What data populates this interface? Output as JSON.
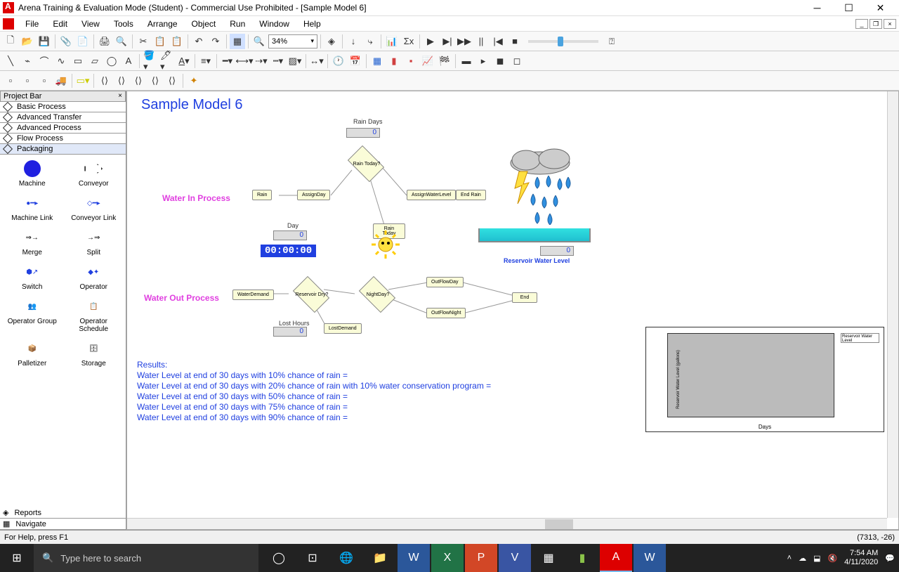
{
  "window": {
    "title": "Arena Training & Evaluation Mode (Student) - Commercial Use Prohibited - [Sample Model 6]"
  },
  "menu": [
    "File",
    "Edit",
    "View",
    "Tools",
    "Arrange",
    "Object",
    "Run",
    "Window",
    "Help"
  ],
  "zoom": "34%",
  "projectbar": {
    "title": "Project Bar",
    "groups": [
      "Basic Process",
      "Advanced Transfer",
      "Advanced Process",
      "Flow Process",
      "Packaging"
    ],
    "items": [
      "Machine",
      "Conveyor",
      "Machine Link",
      "Conveyor Link",
      "Merge",
      "Split",
      "Switch",
      "Operator",
      "Operator Group",
      "Operator Schedule",
      "Palletizer",
      "Storage"
    ],
    "bottom": [
      "Reports",
      "Navigate"
    ]
  },
  "canvas": {
    "title": "Sample Model 6",
    "water_in_label": "Water In Process",
    "water_out_label": "Water Out Process",
    "rain_days_label": "Rain Days",
    "rain_days_value": "0",
    "day_label": "Day",
    "day_value": "0",
    "clock": "00:00:00",
    "lost_hours_label": "Lost Hours",
    "lost_hours_value": "0",
    "reservoir_label": "Reservoir Water Level",
    "reservoir_value": "0",
    "blocks": {
      "rain": "Rain",
      "assign_day": "AssignDay",
      "rain_today_q": "Rain Today?",
      "rain_today": "Rain Today",
      "assign_water": "AssignWaterLevel",
      "end_rain": "End Rain",
      "water_demand": "WaterDemand",
      "reservoir_dry": "Reservoir Dry?",
      "night_day": "NightDay?",
      "out_day": "OutFlowDay",
      "out_night": "OutFlowNight",
      "lost_demand": "LostDemand",
      "end": "End"
    },
    "results_title": "Results:",
    "results": [
      "Water Level at end of 30 days with 10% chance of rain =",
      "Water Level at end of 30 days with 20% chance of rain with 10% water conservation program =",
      "Water Level at end of 30 days with 50% chance of rain =",
      "Water Level at end of 30 days with 75% chance of rain =",
      "Water Level at end of 30 days with 90% chance of rain ="
    ],
    "chart": {
      "xlabel": "Days",
      "ylabel": "Reservoir Water Level (gallons)",
      "legend": "Reservoir Water Level"
    }
  },
  "status": {
    "help": "For Help, press F1",
    "coords": "(7313, -26)"
  },
  "taskbar": {
    "search_placeholder": "Type here to search",
    "time": "7:54 AM",
    "date": "4/11/2020"
  }
}
